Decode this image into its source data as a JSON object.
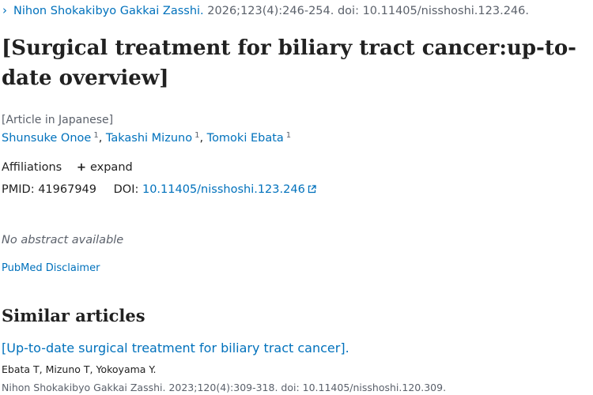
{
  "citation": {
    "journal": "Nihon Shokakibyo Gakkai Zasshi.",
    "details": "2026;123(4):246-254. doi: 10.11405/nisshoshi.123.246."
  },
  "article": {
    "title": "[Surgical treatment for biliary tract cancer:up-to-date overview]",
    "language_note": "[Article in Japanese]",
    "authors": [
      {
        "name": "Shunsuke Onoe",
        "affil": "1"
      },
      {
        "name": "Takashi Mizuno",
        "affil": "1"
      },
      {
        "name": "Tomoki Ebata",
        "affil": "1"
      }
    ],
    "affiliations_label": "Affiliations",
    "expand_label": "expand",
    "pmid_label": "PMID:",
    "pmid": "41967949",
    "doi_label": "DOI:",
    "doi": "10.11405/nisshoshi.123.246",
    "no_abstract": "No abstract available",
    "disclaimer": "PubMed Disclaimer"
  },
  "similar": {
    "heading": "Similar articles",
    "items": [
      {
        "title": "[Up-to-date surgical treatment for biliary tract cancer].",
        "authors": "Ebata T, Mizuno T, Yokoyama Y.",
        "citation": "Nihon Shokakibyo Gakkai Zasshi. 2023;120(4):309-318. doi: 10.11405/nisshoshi.120.309."
      }
    ]
  },
  "colors": {
    "link": "#0071bc",
    "text": "#212121",
    "muted": "#5b616b"
  },
  "icons": [
    "chevron-right-icon",
    "plus-icon",
    "external-link-icon"
  ]
}
